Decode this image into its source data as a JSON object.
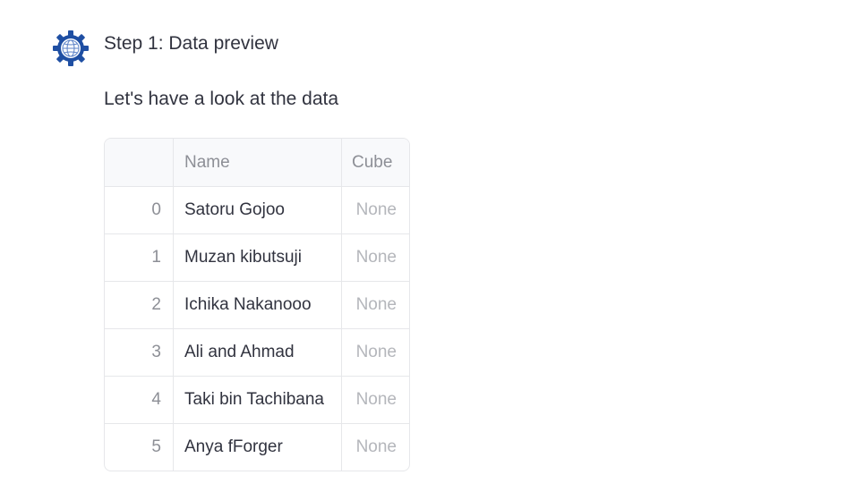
{
  "message": {
    "avatar_icon": "gear-globe-icon",
    "accent_color": "#1f4fa3",
    "title": "Step 1: Data preview",
    "subtitle": "Let's have a look at the data"
  },
  "table": {
    "columns": [
      "",
      "Name",
      "Cube"
    ],
    "rows": [
      {
        "index": "0",
        "name": "Satoru Gojoo",
        "cube": "None"
      },
      {
        "index": "1",
        "name": "Muzan kibutsuji",
        "cube": "None"
      },
      {
        "index": "2",
        "name": "Ichika Nakanooo",
        "cube": "None"
      },
      {
        "index": "3",
        "name": "Ali and Ahmad",
        "cube": "None"
      },
      {
        "index": "4",
        "name": "Taki bin Tachibana",
        "cube": "None"
      },
      {
        "index": "5",
        "name": "Anya fForger",
        "cube": "None"
      }
    ]
  }
}
